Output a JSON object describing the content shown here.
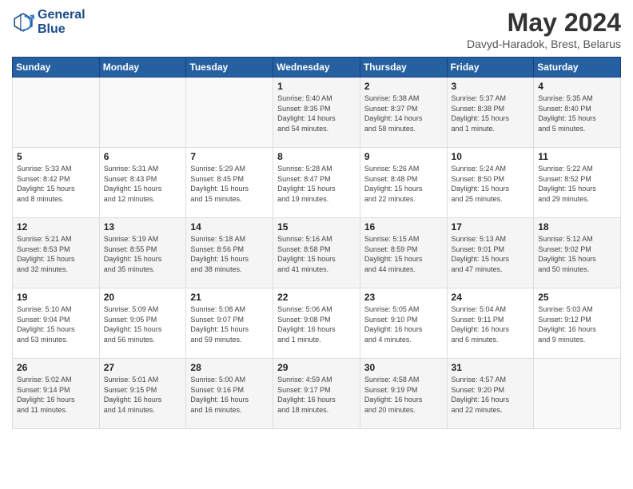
{
  "header": {
    "logo_line1": "General",
    "logo_line2": "Blue",
    "title": "May 2024",
    "location": "Davyd-Haradok, Brest, Belarus"
  },
  "weekdays": [
    "Sunday",
    "Monday",
    "Tuesday",
    "Wednesday",
    "Thursday",
    "Friday",
    "Saturday"
  ],
  "weeks": [
    [
      {
        "day": "",
        "info": ""
      },
      {
        "day": "",
        "info": ""
      },
      {
        "day": "",
        "info": ""
      },
      {
        "day": "1",
        "info": "Sunrise: 5:40 AM\nSunset: 8:35 PM\nDaylight: 14 hours\nand 54 minutes."
      },
      {
        "day": "2",
        "info": "Sunrise: 5:38 AM\nSunset: 8:37 PM\nDaylight: 14 hours\nand 58 minutes."
      },
      {
        "day": "3",
        "info": "Sunrise: 5:37 AM\nSunset: 8:38 PM\nDaylight: 15 hours\nand 1 minute."
      },
      {
        "day": "4",
        "info": "Sunrise: 5:35 AM\nSunset: 8:40 PM\nDaylight: 15 hours\nand 5 minutes."
      }
    ],
    [
      {
        "day": "5",
        "info": "Sunrise: 5:33 AM\nSunset: 8:42 PM\nDaylight: 15 hours\nand 8 minutes."
      },
      {
        "day": "6",
        "info": "Sunrise: 5:31 AM\nSunset: 8:43 PM\nDaylight: 15 hours\nand 12 minutes."
      },
      {
        "day": "7",
        "info": "Sunrise: 5:29 AM\nSunset: 8:45 PM\nDaylight: 15 hours\nand 15 minutes."
      },
      {
        "day": "8",
        "info": "Sunrise: 5:28 AM\nSunset: 8:47 PM\nDaylight: 15 hours\nand 19 minutes."
      },
      {
        "day": "9",
        "info": "Sunrise: 5:26 AM\nSunset: 8:48 PM\nDaylight: 15 hours\nand 22 minutes."
      },
      {
        "day": "10",
        "info": "Sunrise: 5:24 AM\nSunset: 8:50 PM\nDaylight: 15 hours\nand 25 minutes."
      },
      {
        "day": "11",
        "info": "Sunrise: 5:22 AM\nSunset: 8:52 PM\nDaylight: 15 hours\nand 29 minutes."
      }
    ],
    [
      {
        "day": "12",
        "info": "Sunrise: 5:21 AM\nSunset: 8:53 PM\nDaylight: 15 hours\nand 32 minutes."
      },
      {
        "day": "13",
        "info": "Sunrise: 5:19 AM\nSunset: 8:55 PM\nDaylight: 15 hours\nand 35 minutes."
      },
      {
        "day": "14",
        "info": "Sunrise: 5:18 AM\nSunset: 8:56 PM\nDaylight: 15 hours\nand 38 minutes."
      },
      {
        "day": "15",
        "info": "Sunrise: 5:16 AM\nSunset: 8:58 PM\nDaylight: 15 hours\nand 41 minutes."
      },
      {
        "day": "16",
        "info": "Sunrise: 5:15 AM\nSunset: 8:59 PM\nDaylight: 15 hours\nand 44 minutes."
      },
      {
        "day": "17",
        "info": "Sunrise: 5:13 AM\nSunset: 9:01 PM\nDaylight: 15 hours\nand 47 minutes."
      },
      {
        "day": "18",
        "info": "Sunrise: 5:12 AM\nSunset: 9:02 PM\nDaylight: 15 hours\nand 50 minutes."
      }
    ],
    [
      {
        "day": "19",
        "info": "Sunrise: 5:10 AM\nSunset: 9:04 PM\nDaylight: 15 hours\nand 53 minutes."
      },
      {
        "day": "20",
        "info": "Sunrise: 5:09 AM\nSunset: 9:05 PM\nDaylight: 15 hours\nand 56 minutes."
      },
      {
        "day": "21",
        "info": "Sunrise: 5:08 AM\nSunset: 9:07 PM\nDaylight: 15 hours\nand 59 minutes."
      },
      {
        "day": "22",
        "info": "Sunrise: 5:06 AM\nSunset: 9:08 PM\nDaylight: 16 hours\nand 1 minute."
      },
      {
        "day": "23",
        "info": "Sunrise: 5:05 AM\nSunset: 9:10 PM\nDaylight: 16 hours\nand 4 minutes."
      },
      {
        "day": "24",
        "info": "Sunrise: 5:04 AM\nSunset: 9:11 PM\nDaylight: 16 hours\nand 6 minutes."
      },
      {
        "day": "25",
        "info": "Sunrise: 5:03 AM\nSunset: 9:12 PM\nDaylight: 16 hours\nand 9 minutes."
      }
    ],
    [
      {
        "day": "26",
        "info": "Sunrise: 5:02 AM\nSunset: 9:14 PM\nDaylight: 16 hours\nand 11 minutes."
      },
      {
        "day": "27",
        "info": "Sunrise: 5:01 AM\nSunset: 9:15 PM\nDaylight: 16 hours\nand 14 minutes."
      },
      {
        "day": "28",
        "info": "Sunrise: 5:00 AM\nSunset: 9:16 PM\nDaylight: 16 hours\nand 16 minutes."
      },
      {
        "day": "29",
        "info": "Sunrise: 4:59 AM\nSunset: 9:17 PM\nDaylight: 16 hours\nand 18 minutes."
      },
      {
        "day": "30",
        "info": "Sunrise: 4:58 AM\nSunset: 9:19 PM\nDaylight: 16 hours\nand 20 minutes."
      },
      {
        "day": "31",
        "info": "Sunrise: 4:57 AM\nSunset: 9:20 PM\nDaylight: 16 hours\nand 22 minutes."
      },
      {
        "day": "",
        "info": ""
      }
    ]
  ]
}
